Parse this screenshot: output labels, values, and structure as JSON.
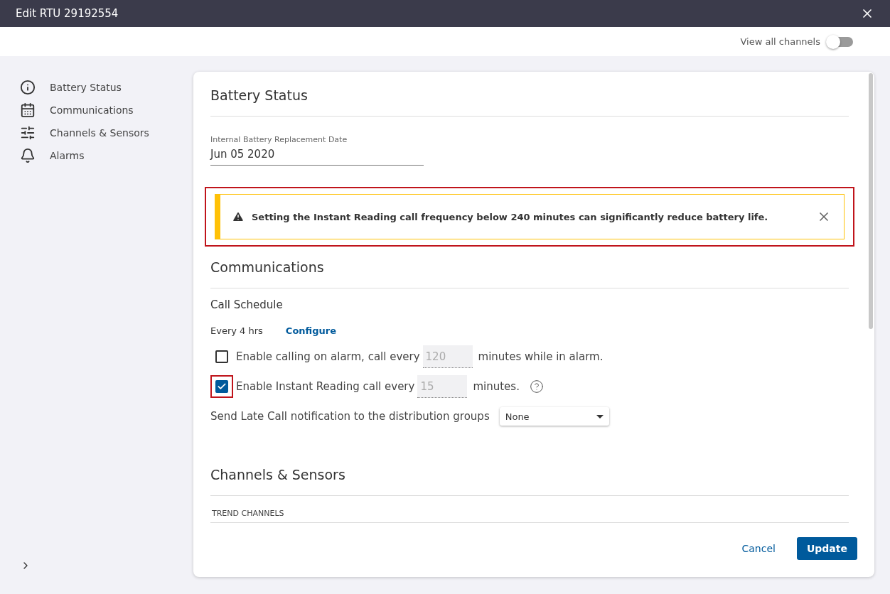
{
  "window": {
    "title": "Edit RTU 29192554"
  },
  "toolbar": {
    "toggle_label": "View all channels",
    "toggle_on": false
  },
  "sidebar": {
    "items": [
      {
        "label": "Battery Status",
        "kind": "info"
      },
      {
        "label": "Communications",
        "kind": "calendar"
      },
      {
        "label": "Channels & Sensors",
        "kind": "sliders"
      },
      {
        "label": "Alarms",
        "kind": "bell"
      }
    ]
  },
  "battery": {
    "heading": "Battery Status",
    "field_label": "Internal Battery Replacement Date",
    "field_value": "Jun 05 2020"
  },
  "alert": {
    "text": "Setting the Instant Reading call frequency below 240 minutes can significantly reduce battery life.",
    "highlighted": true
  },
  "communications": {
    "heading": "Communications",
    "subheading": "Call Schedule",
    "schedule": "Every 4 hrs",
    "configure_link": "Configure",
    "options": [
      {
        "before": "Enable calling on alarm, call every",
        "value": "120",
        "after": "minutes while in alarm.",
        "checked": false,
        "highlighted": false,
        "help": false
      },
      {
        "before": "Enable Instant Reading call every",
        "value": "15",
        "after": "minutes.",
        "checked": true,
        "highlighted": true,
        "help": true
      }
    ],
    "late_call_label": "Send Late Call notification to the distribution groups",
    "late_call_value": "None"
  },
  "channels": {
    "heading": "Channels & Sensors",
    "subheading": "TREND CHANNELS"
  },
  "buttons": {
    "cancel": "Cancel",
    "update": "Update"
  }
}
